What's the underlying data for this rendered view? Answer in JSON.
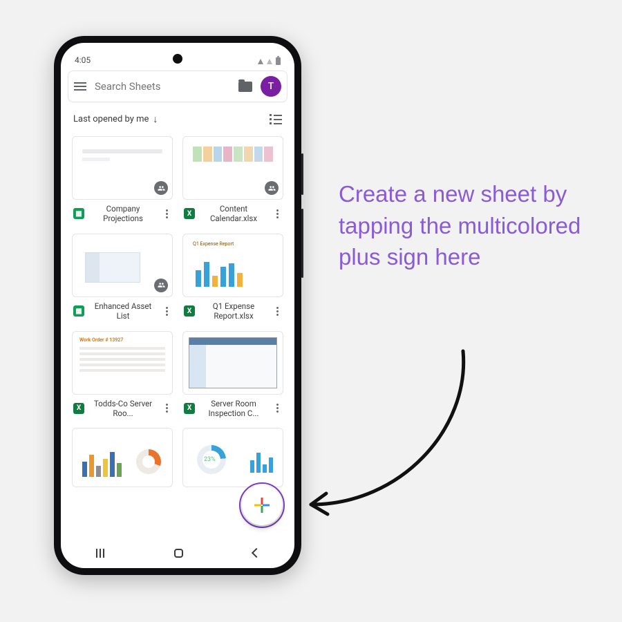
{
  "status": {
    "time": "4:05"
  },
  "searchbar": {
    "placeholder": "Search Sheets",
    "avatar_initial": "T"
  },
  "sort": {
    "label": "Last opened by me"
  },
  "files": [
    {
      "name": "Company Projections",
      "type": "sheets",
      "shared": true
    },
    {
      "name": "Content Calendar.xlsx",
      "type": "excel",
      "shared": true
    },
    {
      "name": "Enhanced Asset List",
      "type": "sheets",
      "shared": true
    },
    {
      "name": "Q1 Expense Report.xlsx",
      "type": "excel",
      "shared": false
    },
    {
      "name": "Todds-Co Server Roo...",
      "type": "excel",
      "shared": false
    },
    {
      "name": "Server Room Inspection C...",
      "type": "excel",
      "shared": false
    }
  ],
  "thumb8_percent": "23%",
  "callout": "Create a new sheet by tapping the multicolored plus sign here"
}
